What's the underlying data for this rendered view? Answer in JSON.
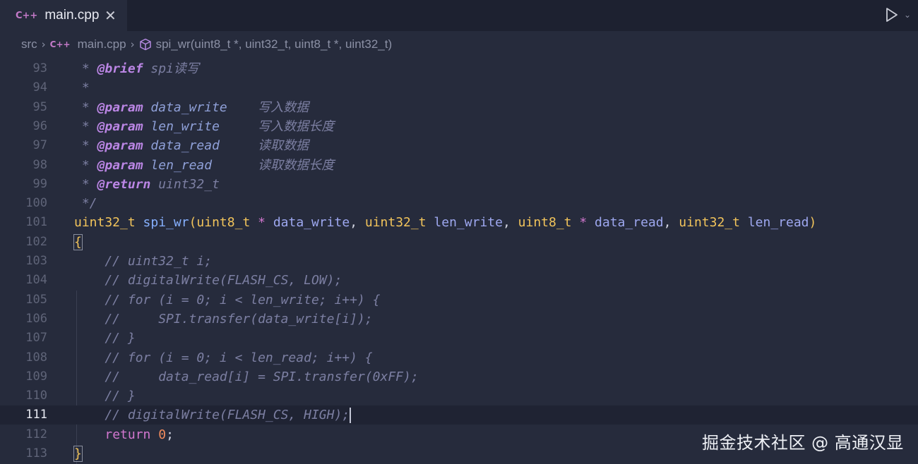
{
  "tab": {
    "lang_icon": "C++",
    "title": "main.cpp",
    "close_glyph": "✕"
  },
  "toolbar": {
    "run_icon": "play-icon",
    "run_menu_glyph": "⌄"
  },
  "breadcrumb": {
    "folder": "src",
    "separator": "›",
    "lang_icon": "C++",
    "file": "main.cpp",
    "symbol_icon": "cube-icon",
    "symbol": "spi_wr(uint8_t *, uint32_t, uint8_t *, uint32_t)"
  },
  "editor": {
    "active_line": 111,
    "lines": [
      {
        "num": "93",
        "tokens": [
          {
            "c": "cm",
            "t": " * "
          },
          {
            "c": "ct",
            "t": "@brief"
          },
          {
            "c": "cm",
            "t": " spi"
          },
          {
            "c": "cz",
            "t": "读写"
          }
        ]
      },
      {
        "num": "94",
        "tokens": [
          {
            "c": "cm",
            "t": " *"
          }
        ]
      },
      {
        "num": "95",
        "tokens": [
          {
            "c": "cm",
            "t": " * "
          },
          {
            "c": "ct",
            "t": "@param"
          },
          {
            "c": "cm",
            "t": " "
          },
          {
            "c": "cp",
            "t": "data_write"
          },
          {
            "c": "cm",
            "t": "    "
          },
          {
            "c": "cz",
            "t": "写入数据"
          }
        ]
      },
      {
        "num": "96",
        "tokens": [
          {
            "c": "cm",
            "t": " * "
          },
          {
            "c": "ct",
            "t": "@param"
          },
          {
            "c": "cm",
            "t": " "
          },
          {
            "c": "cp",
            "t": "len_write"
          },
          {
            "c": "cm",
            "t": "     "
          },
          {
            "c": "cz",
            "t": "写入数据长度"
          }
        ]
      },
      {
        "num": "97",
        "tokens": [
          {
            "c": "cm",
            "t": " * "
          },
          {
            "c": "ct",
            "t": "@param"
          },
          {
            "c": "cm",
            "t": " "
          },
          {
            "c": "cp",
            "t": "data_read"
          },
          {
            "c": "cm",
            "t": "     "
          },
          {
            "c": "cz",
            "t": "读取数据"
          }
        ]
      },
      {
        "num": "98",
        "tokens": [
          {
            "c": "cm",
            "t": " * "
          },
          {
            "c": "ct",
            "t": "@param"
          },
          {
            "c": "cm",
            "t": " "
          },
          {
            "c": "cp",
            "t": "len_read"
          },
          {
            "c": "cm",
            "t": "      "
          },
          {
            "c": "cz",
            "t": "读取数据长度"
          }
        ]
      },
      {
        "num": "99",
        "tokens": [
          {
            "c": "cm",
            "t": " * "
          },
          {
            "c": "ct",
            "t": "@return"
          },
          {
            "c": "cm",
            "t": " uint32_t"
          }
        ]
      },
      {
        "num": "100",
        "tokens": [
          {
            "c": "cm",
            "t": " */"
          }
        ]
      },
      {
        "num": "101",
        "tokens": [
          {
            "c": "ty",
            "t": "uint32_t"
          },
          {
            "c": "pn",
            "t": " "
          },
          {
            "c": "fn",
            "t": "spi_wr"
          },
          {
            "c": "ty",
            "t": "("
          },
          {
            "c": "ty",
            "t": "uint8_t"
          },
          {
            "c": "pn",
            "t": " "
          },
          {
            "c": "op",
            "t": "*"
          },
          {
            "c": "pn",
            "t": " "
          },
          {
            "c": "pm",
            "t": "data_write"
          },
          {
            "c": "pn",
            "t": ", "
          },
          {
            "c": "ty",
            "t": "uint32_t"
          },
          {
            "c": "pn",
            "t": " "
          },
          {
            "c": "pm",
            "t": "len_write"
          },
          {
            "c": "pn",
            "t": ", "
          },
          {
            "c": "ty",
            "t": "uint8_t"
          },
          {
            "c": "pn",
            "t": " "
          },
          {
            "c": "op",
            "t": "*"
          },
          {
            "c": "pn",
            "t": " "
          },
          {
            "c": "pm",
            "t": "data_read"
          },
          {
            "c": "pn",
            "t": ", "
          },
          {
            "c": "ty",
            "t": "uint32_t"
          },
          {
            "c": "pn",
            "t": " "
          },
          {
            "c": "pm",
            "t": "len_read"
          },
          {
            "c": "ty",
            "t": ")"
          }
        ]
      },
      {
        "num": "102",
        "tokens": [
          {
            "c": "br",
            "t": "{"
          }
        ]
      },
      {
        "num": "103",
        "tokens": [
          {
            "c": "cm",
            "t": "    // uint32_t i;"
          }
        ]
      },
      {
        "num": "104",
        "tokens": [
          {
            "c": "cm",
            "t": "    // digitalWrite(FLASH_CS, LOW);"
          }
        ]
      },
      {
        "num": "105",
        "tokens": [
          {
            "c": "cm",
            "t": "    // for (i = 0; i < len_write; i++) {"
          }
        ]
      },
      {
        "num": "106",
        "tokens": [
          {
            "c": "cm",
            "t": "    //     SPI.transfer(data_write[i]);"
          }
        ]
      },
      {
        "num": "107",
        "tokens": [
          {
            "c": "cm",
            "t": "    // }"
          }
        ]
      },
      {
        "num": "108",
        "tokens": [
          {
            "c": "cm",
            "t": "    // for (i = 0; i < len_read; i++) {"
          }
        ]
      },
      {
        "num": "109",
        "tokens": [
          {
            "c": "cm",
            "t": "    //     data_read[i] = SPI.transfer(0xFF);"
          }
        ]
      },
      {
        "num": "110",
        "tokens": [
          {
            "c": "cm",
            "t": "    // }"
          }
        ]
      },
      {
        "num": "111",
        "tokens": [
          {
            "c": "cm",
            "t": "    // digitalWrite(FLASH_CS, HIGH);"
          }
        ]
      },
      {
        "num": "112",
        "tokens": [
          {
            "c": "pn",
            "t": "    "
          },
          {
            "c": "kw",
            "t": "return"
          },
          {
            "c": "pn",
            "t": " "
          },
          {
            "c": "nm",
            "t": "0"
          },
          {
            "c": "pn",
            "t": ";"
          }
        ]
      },
      {
        "num": "113",
        "tokens": [
          {
            "c": "br",
            "t": "}"
          }
        ]
      }
    ]
  },
  "watermark": "掘金技术社区 @ 高通汉显"
}
